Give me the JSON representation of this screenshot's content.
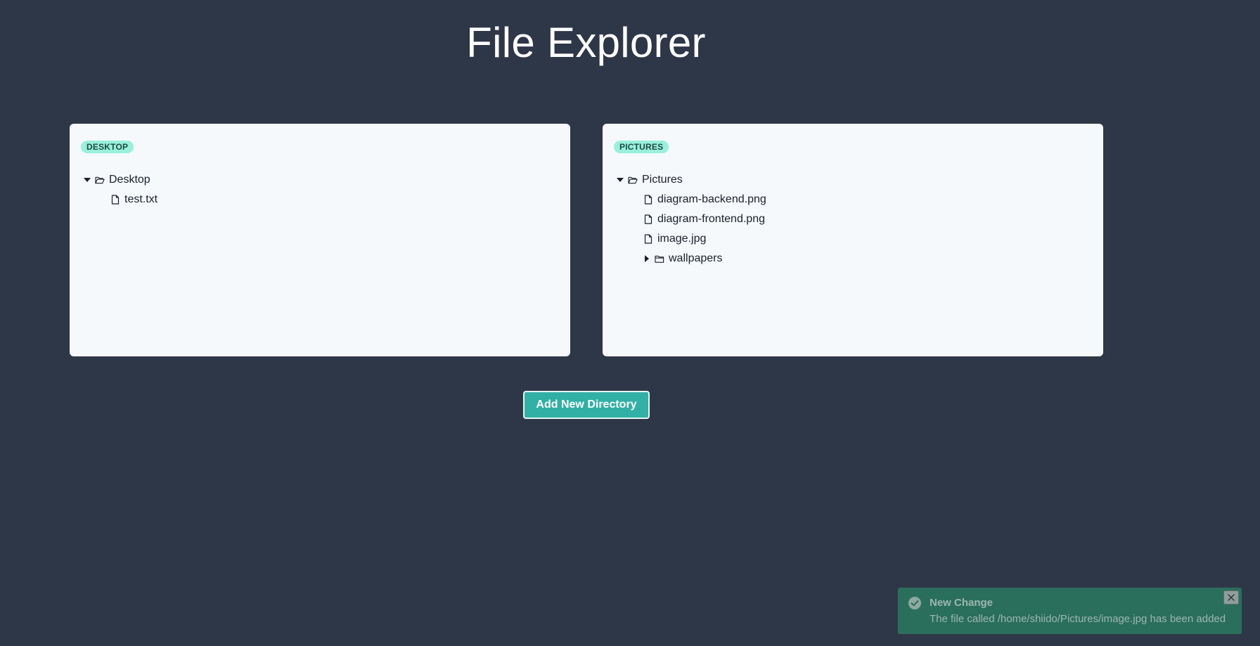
{
  "header": {
    "title": "File Explorer"
  },
  "panels": [
    {
      "badge": "DESKTOP",
      "root": "Desktop",
      "children": [
        {
          "type": "file",
          "name": "test.txt"
        }
      ]
    },
    {
      "badge": "PICTURES",
      "root": "Pictures",
      "children": [
        {
          "type": "file",
          "name": "diagram-backend.png"
        },
        {
          "type": "file",
          "name": "diagram-frontend.png"
        },
        {
          "type": "file",
          "name": "image.jpg"
        },
        {
          "type": "folder",
          "name": "wallpapers",
          "expanded": false
        }
      ]
    }
  ],
  "actions": {
    "add_directory_label": "Add New Directory"
  },
  "toast": {
    "title": "New Change",
    "message": "The file called /home/shiido/Pictures/image.jpg has been added"
  },
  "colors": {
    "background": "#2e3748",
    "panel": "#f5f9fc",
    "badge": "#99f0dc",
    "button": "#31b0a5",
    "toast": "#2a6f5c"
  },
  "icons": {
    "expanded": "caret-down-icon",
    "collapsed": "caret-right-icon",
    "open_folder": "folder-open-icon",
    "folder": "folder-icon",
    "file": "file-icon",
    "check": "check-circle-icon",
    "close": "close-icon"
  }
}
